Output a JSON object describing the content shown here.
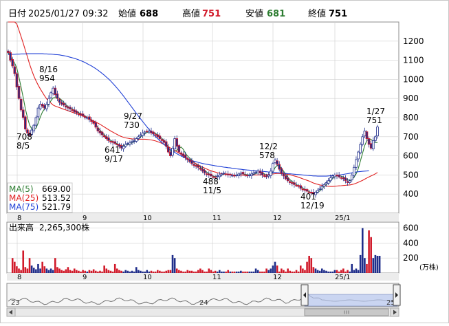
{
  "header": {
    "date_label": "日付",
    "datetime": "2025/01/27 09:32",
    "open_label": "始値",
    "open_value": "688",
    "high_label": "高値",
    "high_value": "751",
    "low_label": "安値",
    "low_value": "681",
    "close_label": "終値",
    "close_value": "751"
  },
  "colors": {
    "up": "#1f2d8a",
    "down": "#d11a2a",
    "ma5": "#2e7d32",
    "ma25": "#e02020",
    "ma75": "#1f3fd6",
    "volume": "#1f2d8a",
    "grid": "#cfcfcf",
    "nav_fill": "#b8c8f0",
    "nav_line": "#707070"
  },
  "legend": [
    {
      "label": "MA(5)",
      "value": "669.00",
      "color": "#2e7d32"
    },
    {
      "label": "MA(25)",
      "value": "513.52",
      "color": "#e02020"
    },
    {
      "label": "MA(75)",
      "value": "521.79",
      "color": "#1f3fd6"
    }
  ],
  "volume_header": {
    "label": "出来高",
    "value": "2,265,300株"
  },
  "volume_unit": "(万株)",
  "navigator": {
    "labels": [
      "23",
      "24",
      "25"
    ]
  },
  "chart_data": [
    {
      "type": "candlestick",
      "ylim": [
        300,
        1300
      ],
      "y_ticks": [
        400,
        500,
        600,
        700,
        800,
        900,
        1000,
        1100,
        1200
      ],
      "x_ticks": [
        "8",
        "9",
        "10",
        "11",
        "12",
        "25/1"
      ],
      "grid": true,
      "close_series": [
        1140,
        1100,
        1070,
        1030,
        960,
        900,
        840,
        800,
        740,
        720,
        708,
        735,
        760,
        800,
        850,
        870,
        860,
        850,
        870,
        900,
        930,
        954,
        920,
        900,
        880,
        870,
        865,
        855,
        850,
        845,
        840,
        830,
        825,
        820,
        815,
        810,
        800,
        800,
        790,
        780,
        770,
        750,
        730,
        720,
        710,
        700,
        690,
        680,
        675,
        670,
        665,
        660,
        650,
        641,
        650,
        660,
        665,
        670,
        675,
        680,
        690,
        700,
        710,
        720,
        725,
        728,
        730,
        720,
        715,
        710,
        700,
        690,
        680,
        670,
        650,
        620,
        600,
        640,
        690,
        650,
        620,
        610,
        600,
        590,
        580,
        570,
        560,
        550,
        545,
        540,
        530,
        520,
        510,
        505,
        500,
        495,
        490,
        488,
        495,
        500,
        505,
        510,
        505,
        500,
        500,
        498,
        495,
        500,
        505,
        510,
        505,
        500,
        495,
        500,
        505,
        510,
        515,
        520,
        510,
        500,
        495,
        490,
        500,
        520,
        560,
        578,
        555,
        530,
        510,
        495,
        480,
        470,
        460,
        455,
        450,
        445,
        440,
        430,
        425,
        420,
        415,
        410,
        405,
        401,
        410,
        420,
        430,
        440,
        450,
        460,
        470,
        485,
        495,
        500,
        495,
        490,
        485,
        480,
        470,
        460,
        470,
        500,
        540,
        580,
        620,
        660,
        700,
        730,
        690,
        660,
        640,
        680,
        700,
        751
      ],
      "annotations": [
        {
          "label": "8/16",
          "value": "954"
        },
        {
          "label": "708",
          "value": "8/5"
        },
        {
          "label": "641",
          "value": "9/17"
        },
        {
          "label": "9/27",
          "value": "730"
        },
        {
          "label": "488",
          "value": "11/5"
        },
        {
          "label": "12/2",
          "value": "578"
        },
        {
          "label": "401",
          "value": "12/19"
        },
        {
          "label": "1/27",
          "value": "751"
        }
      ],
      "series": [
        {
          "name": "MA(5)",
          "values": [
            1140,
            1120,
            1103,
            1085,
            1060,
            1012,
            960,
            906,
            848,
            800,
            762,
            741,
            735,
            745,
            771,
            803,
            829,
            846,
            858,
            870,
            888,
            903,
            905,
            904,
            901,
            892,
            879,
            868,
            858,
            851,
            845,
            839,
            832,
            826,
            820,
            814,
            808,
            801,
            795,
            787,
            778,
            764,
            748,
            734,
            722,
            710,
            700,
            690,
            681,
            674,
            668,
            664,
            658,
            652,
            653,
            656,
            658,
            662,
            668,
            674,
            681,
            689,
            699,
            708,
            716,
            722,
            726,
            725,
            722,
            717,
            710,
            701,
            691,
            680,
            666,
            646,
            626,
            620,
            624,
            630,
            640,
            646,
            634,
            614,
            600,
            588,
            578,
            566,
            557,
            549,
            541,
            533,
            524,
            515,
            507,
            500,
            494,
            491,
            493,
            496,
            500,
            505,
            504,
            503,
            502,
            500,
            499,
            500,
            502,
            506,
            506,
            503,
            501,
            500,
            501,
            503,
            507,
            513,
            514,
            510,
            506,
            499,
            497,
            503,
            516,
            538,
            550,
            548,
            536,
            520,
            503,
            489,
            476,
            466,
            458,
            450,
            444,
            437,
            431,
            425,
            419,
            413,
            408,
            403,
            405,
            409,
            417,
            428,
            440,
            450,
            460,
            471,
            481,
            491,
            496,
            496,
            494,
            490,
            484,
            476,
            471,
            476,
            488,
            506,
            534,
            574,
            614,
            654,
            679,
            690,
            686,
            674,
            671,
            669
          ]
        },
        {
          "name": "MA(25)",
          "values": [
            1400,
            1375,
            1350,
            1322,
            1290,
            1258,
            1224,
            1190,
            1153,
            1118,
            1080,
            1048,
            1018,
            992,
            970,
            950,
            932,
            914,
            898,
            886,
            876,
            866,
            860,
            856,
            852,
            848,
            844,
            840,
            836,
            832,
            828,
            824,
            820,
            816,
            812,
            808,
            803,
            798,
            793,
            788,
            783,
            777,
            771,
            765,
            758,
            751,
            744,
            737,
            730,
            724,
            718,
            712,
            706,
            701,
            697,
            694,
            692,
            690,
            689,
            688,
            687,
            687,
            687,
            687,
            687,
            686,
            685,
            683,
            681,
            678,
            674,
            670,
            665,
            660,
            654,
            648,
            641,
            634,
            628,
            621,
            614,
            607,
            600,
            593,
            586,
            579,
            572,
            565,
            559,
            553,
            547,
            541,
            536,
            531,
            526,
            522,
            518,
            515,
            512,
            509,
            507,
            505,
            503,
            502,
            501,
            500,
            500,
            499,
            499,
            499,
            499,
            499,
            499,
            499,
            499,
            500,
            500,
            500,
            501,
            501,
            501,
            501,
            502,
            503,
            505,
            507,
            508,
            508,
            507,
            506,
            505,
            503,
            501,
            498,
            495,
            492,
            488,
            484,
            480,
            476,
            472,
            468,
            463,
            458,
            454,
            451,
            448,
            446,
            444,
            442,
            441,
            440,
            440,
            441,
            442,
            443,
            444,
            445,
            446,
            447,
            448,
            450,
            453,
            457,
            462,
            467,
            472,
            478,
            484,
            490,
            495,
            500,
            506,
            513
          ]
        },
        {
          "name": "MA(75)",
          "values": [
            1130,
            1130,
            1131,
            1131,
            1132,
            1132,
            1133,
            1133,
            1133,
            1134,
            1134,
            1134,
            1134,
            1134,
            1134,
            1134,
            1134,
            1133,
            1133,
            1132,
            1132,
            1131,
            1130,
            1129,
            1128,
            1126,
            1124,
            1122,
            1119,
            1116,
            1113,
            1110,
            1106,
            1102,
            1098,
            1093,
            1088,
            1082,
            1076,
            1070,
            1063,
            1056,
            1048,
            1040,
            1031,
            1022,
            1012,
            1002,
            991,
            979,
            967,
            954,
            941,
            927,
            913,
            898,
            883,
            868,
            853,
            838,
            823,
            808,
            793,
            779,
            765,
            751,
            738,
            725,
            713,
            701,
            690,
            679,
            669,
            659,
            650,
            641,
            633,
            625,
            618,
            611,
            605,
            599,
            594,
            589,
            584,
            580,
            576,
            572,
            569,
            566,
            563,
            560,
            558,
            556,
            554,
            552,
            550,
            548,
            546,
            545,
            543,
            541,
            540,
            538,
            537,
            535,
            534,
            532,
            531,
            530,
            528,
            527,
            526,
            525,
            524,
            523,
            522,
            521,
            520,
            519,
            518,
            517,
            516,
            515,
            514,
            513,
            512,
            511,
            510,
            509,
            508,
            507,
            506,
            505,
            504,
            503,
            502,
            501,
            500,
            499,
            498,
            497,
            496,
            495,
            495,
            494,
            494,
            494,
            494,
            494,
            495,
            496,
            497,
            498,
            499,
            500,
            501,
            503,
            505,
            507,
            509,
            511,
            513,
            515,
            517,
            518,
            519,
            520,
            521,
            522
          ]
        }
      ]
    },
    {
      "type": "bar",
      "ylim": [
        0,
        680
      ],
      "y_ticks": [
        200,
        400,
        600
      ],
      "x_ticks": [
        "8",
        "9",
        "10",
        "11",
        "12",
        "25/1"
      ],
      "values": [
        0,
        0,
        200,
        150,
        90,
        60,
        40,
        300,
        80,
        60,
        200,
        100,
        70,
        50,
        120,
        60,
        150,
        90,
        60,
        40,
        60,
        40,
        200,
        80,
        60,
        40,
        30,
        50,
        80,
        40,
        30,
        60,
        40,
        30,
        20,
        40,
        30,
        20,
        40,
        30,
        50,
        30,
        20,
        30,
        20,
        100,
        60,
        40,
        30,
        20,
        120,
        60,
        40,
        30,
        20,
        40,
        30,
        20,
        30,
        20,
        80,
        40,
        30,
        20,
        20,
        40,
        20,
        30,
        20,
        20,
        40,
        30,
        20,
        20,
        30,
        40,
        40,
        240,
        200,
        60,
        40,
        30,
        20,
        20,
        40,
        30,
        30,
        20,
        20,
        40,
        60,
        40,
        20,
        20,
        60,
        40,
        20,
        30,
        20,
        40,
        20,
        20,
        20,
        40,
        20,
        20,
        20,
        20,
        20,
        30,
        20,
        20,
        20,
        20,
        20,
        20,
        60,
        40,
        20,
        20,
        20,
        60,
        40,
        60,
        100,
        150,
        100,
        20,
        60,
        40,
        20,
        60,
        30,
        20,
        20,
        40,
        20,
        100,
        60,
        40,
        150,
        230,
        200,
        80,
        60,
        40,
        30,
        60,
        40,
        30,
        20,
        20,
        20,
        40,
        40,
        20,
        40,
        60,
        20,
        40,
        20,
        120,
        40,
        60,
        40,
        240,
        600,
        200,
        120,
        570,
        480,
        200,
        240,
        230,
        230
      ]
    }
  ]
}
